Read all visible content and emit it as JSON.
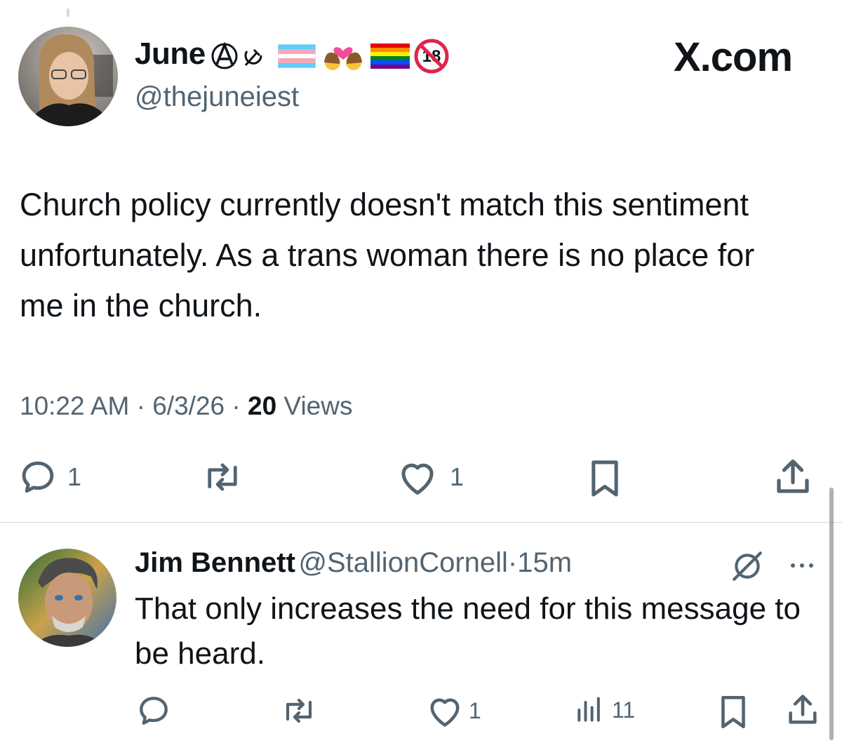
{
  "brand": {
    "label": "X.com"
  },
  "main_tweet": {
    "display_name": "June",
    "handle": "@thejuneiest",
    "text": "Church policy currently doesn't match this sentiment unfortunately.  As a trans woman there is no place for me in the church.",
    "time": "10:22 AM",
    "date": "6/3/26",
    "sep": "·",
    "views_count": "20",
    "views_label": "Views",
    "actions": {
      "reply_count": "1",
      "like_count": "1"
    }
  },
  "reply": {
    "display_name": "Jim Bennett",
    "handle": "@StallionCornell",
    "sep": "·",
    "age": "15m",
    "text": "That only increases the need for this message to be heard.",
    "actions": {
      "like_count": "1",
      "views_count": "11"
    }
  },
  "colors": {
    "text": "#0f1419",
    "muted": "#536471",
    "divider": "#cfd9de",
    "trans_blue": "#5bcefa",
    "trans_pink": "#f5a9b8"
  },
  "icons": [
    "anarchy-icon",
    "hammer-sickle-icon",
    "trans-flag-icon",
    "couple-with-heart-icon",
    "rainbow-flag-icon",
    "no-under-18-icon",
    "reply-icon",
    "repost-icon",
    "like-icon",
    "bookmark-icon",
    "share-icon",
    "views-icon",
    "grok-icon",
    "more-icon"
  ]
}
